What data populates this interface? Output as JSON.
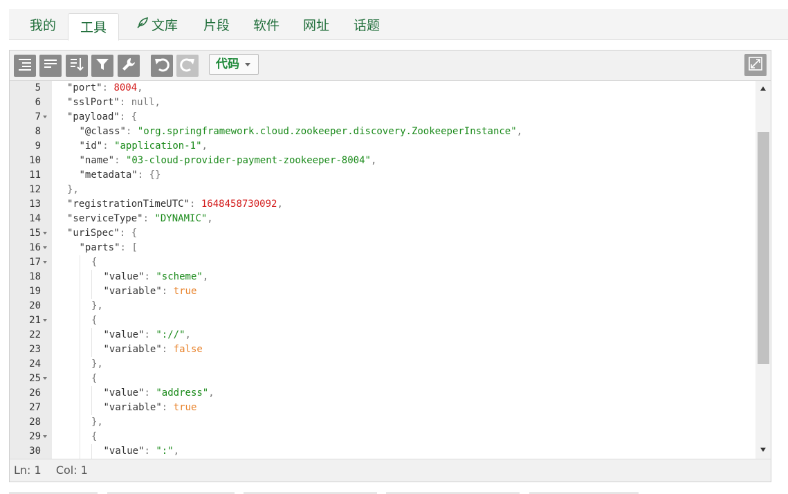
{
  "tabs": [
    {
      "label": "我的",
      "active": false
    },
    {
      "label": "工具",
      "active": true
    },
    {
      "label": "文库",
      "active": false,
      "icon": "feather-icon"
    },
    {
      "label": "片段",
      "active": false
    },
    {
      "label": "软件",
      "active": false
    },
    {
      "label": "网址",
      "active": false
    },
    {
      "label": "话题",
      "active": false
    }
  ],
  "toolbar": {
    "buttons": [
      "format-icon",
      "compact-icon",
      "sort-icon",
      "filter-icon",
      "repair-icon",
      "undo-icon",
      "redo-icon",
      "fullscreen-icon"
    ],
    "mode_label": "代码"
  },
  "editor": {
    "lines": [
      {
        "n": "5",
        "fold": false,
        "indent": 1,
        "tokens": [
          [
            "k",
            "\"port\""
          ],
          [
            "p",
            ": "
          ],
          [
            "n",
            "8004"
          ],
          [
            "p",
            ","
          ]
        ]
      },
      {
        "n": "6",
        "fold": false,
        "indent": 1,
        "tokens": [
          [
            "k",
            "\"sslPort\""
          ],
          [
            "p",
            ": "
          ],
          [
            "null",
            "null"
          ],
          [
            "p",
            ","
          ]
        ]
      },
      {
        "n": "7",
        "fold": true,
        "indent": 1,
        "tokens": [
          [
            "k",
            "\"payload\""
          ],
          [
            "p",
            ": {"
          ]
        ]
      },
      {
        "n": "8",
        "fold": false,
        "indent": 2,
        "tokens": [
          [
            "k",
            "\"@class\""
          ],
          [
            "p",
            ": "
          ],
          [
            "s",
            "\"org.springframework.cloud.zookeeper.discovery.ZookeeperInstance\""
          ],
          [
            "p",
            ","
          ]
        ]
      },
      {
        "n": "9",
        "fold": false,
        "indent": 2,
        "tokens": [
          [
            "k",
            "\"id\""
          ],
          [
            "p",
            ": "
          ],
          [
            "s",
            "\"application-1\""
          ],
          [
            "p",
            ","
          ]
        ]
      },
      {
        "n": "10",
        "fold": false,
        "indent": 2,
        "tokens": [
          [
            "k",
            "\"name\""
          ],
          [
            "p",
            ": "
          ],
          [
            "s",
            "\"03-cloud-provider-payment-zookeeper-8004\""
          ],
          [
            "p",
            ","
          ]
        ]
      },
      {
        "n": "11",
        "fold": false,
        "indent": 2,
        "tokens": [
          [
            "k",
            "\"metadata\""
          ],
          [
            "p",
            ": {}"
          ]
        ]
      },
      {
        "n": "12",
        "fold": false,
        "indent": 1,
        "tokens": [
          [
            "p",
            "},"
          ]
        ]
      },
      {
        "n": "13",
        "fold": false,
        "indent": 1,
        "tokens": [
          [
            "k",
            "\"registrationTimeUTC\""
          ],
          [
            "p",
            ": "
          ],
          [
            "n",
            "1648458730092"
          ],
          [
            "p",
            ","
          ]
        ]
      },
      {
        "n": "14",
        "fold": false,
        "indent": 1,
        "tokens": [
          [
            "k",
            "\"serviceType\""
          ],
          [
            "p",
            ": "
          ],
          [
            "s",
            "\"DYNAMIC\""
          ],
          [
            "p",
            ","
          ]
        ]
      },
      {
        "n": "15",
        "fold": true,
        "indent": 1,
        "tokens": [
          [
            "k",
            "\"uriSpec\""
          ],
          [
            "p",
            ": {"
          ]
        ]
      },
      {
        "n": "16",
        "fold": true,
        "indent": 2,
        "tokens": [
          [
            "k",
            "\"parts\""
          ],
          [
            "p",
            ": ["
          ]
        ]
      },
      {
        "n": "17",
        "fold": true,
        "indent": 3,
        "tokens": [
          [
            "p",
            "{"
          ]
        ]
      },
      {
        "n": "18",
        "fold": false,
        "indent": 4,
        "tokens": [
          [
            "k",
            "\"value\""
          ],
          [
            "p",
            ": "
          ],
          [
            "s",
            "\"scheme\""
          ],
          [
            "p",
            ","
          ]
        ]
      },
      {
        "n": "19",
        "fold": false,
        "indent": 4,
        "tokens": [
          [
            "k",
            "\"variable\""
          ],
          [
            "p",
            ": "
          ],
          [
            "b",
            "true"
          ]
        ]
      },
      {
        "n": "20",
        "fold": false,
        "indent": 3,
        "tokens": [
          [
            "p",
            "},"
          ]
        ]
      },
      {
        "n": "21",
        "fold": true,
        "indent": 3,
        "tokens": [
          [
            "p",
            "{"
          ]
        ]
      },
      {
        "n": "22",
        "fold": false,
        "indent": 4,
        "tokens": [
          [
            "k",
            "\"value\""
          ],
          [
            "p",
            ": "
          ],
          [
            "s",
            "\"://\""
          ],
          [
            "p",
            ","
          ]
        ]
      },
      {
        "n": "23",
        "fold": false,
        "indent": 4,
        "tokens": [
          [
            "k",
            "\"variable\""
          ],
          [
            "p",
            ": "
          ],
          [
            "b",
            "false"
          ]
        ]
      },
      {
        "n": "24",
        "fold": false,
        "indent": 3,
        "tokens": [
          [
            "p",
            "},"
          ]
        ]
      },
      {
        "n": "25",
        "fold": true,
        "indent": 3,
        "tokens": [
          [
            "p",
            "{"
          ]
        ]
      },
      {
        "n": "26",
        "fold": false,
        "indent": 4,
        "tokens": [
          [
            "k",
            "\"value\""
          ],
          [
            "p",
            ": "
          ],
          [
            "s",
            "\"address\""
          ],
          [
            "p",
            ","
          ]
        ]
      },
      {
        "n": "27",
        "fold": false,
        "indent": 4,
        "tokens": [
          [
            "k",
            "\"variable\""
          ],
          [
            "p",
            ": "
          ],
          [
            "b",
            "true"
          ]
        ]
      },
      {
        "n": "28",
        "fold": false,
        "indent": 3,
        "tokens": [
          [
            "p",
            "},"
          ]
        ]
      },
      {
        "n": "29",
        "fold": true,
        "indent": 3,
        "tokens": [
          [
            "p",
            "{"
          ]
        ]
      },
      {
        "n": "30",
        "fold": false,
        "indent": 4,
        "tokens": [
          [
            "k",
            "\"value\""
          ],
          [
            "p",
            ": "
          ],
          [
            "s",
            "\":\""
          ],
          [
            "p",
            ","
          ]
        ]
      }
    ]
  },
  "status": {
    "ln": "Ln: 1",
    "col": "Col: 1"
  },
  "colors": {
    "accent": "#226f3c",
    "string": "#1a8a1a",
    "number": "#d31b1b",
    "boolean": "#e8822a"
  }
}
